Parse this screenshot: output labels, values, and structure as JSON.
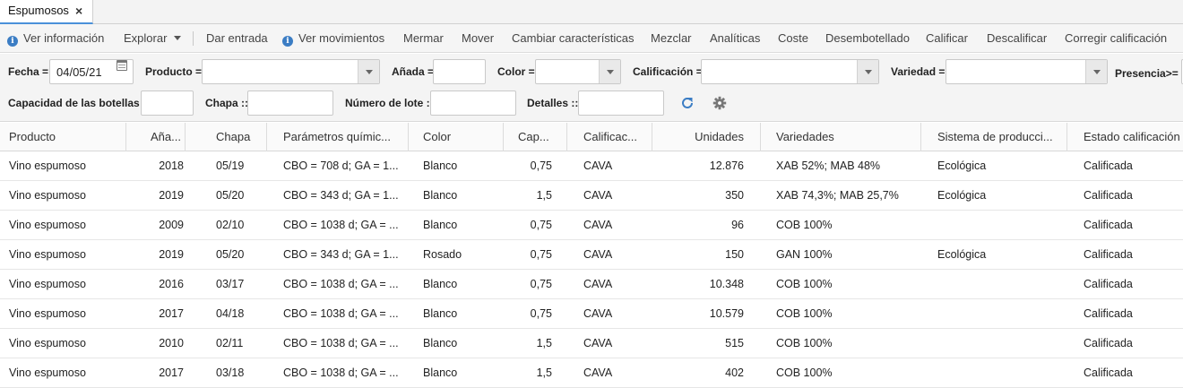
{
  "tab": {
    "title": "Espumosos",
    "close": "×"
  },
  "toolbar": {
    "ver_informacion": "Ver información",
    "explorar": "Explorar",
    "dar_entrada": "Dar entrada",
    "ver_movimientos": "Ver movimientos",
    "mermar": "Mermar",
    "mover": "Mover",
    "cambiar_caracteristicas": "Cambiar características",
    "mezclar": "Mezclar",
    "analiticas": "Analíticas",
    "coste": "Coste",
    "desembotellado": "Desembotellado",
    "calificar": "Calificar",
    "descalificar": "Descalificar",
    "corregir_calificacion": "Corregir calificación"
  },
  "filters": {
    "fecha_label": "Fecha =",
    "fecha_value": "04/05/21",
    "producto_label": "Producto =",
    "anada_label": "Añada =",
    "color_label": "Color =",
    "calificacion_label": "Calificación =",
    "variedad_label": "Variedad =",
    "presencia_label": "Presencia>=",
    "capacidad_label": "Capacidad de las botellas =",
    "chapa_label": "Chapa ::",
    "lote_label": "Número de lote ::",
    "detalles_label": "Detalles ::"
  },
  "table": {
    "headers": [
      "Producto",
      "Aña...",
      "Chapa",
      "Parámetros químic...",
      "Color",
      "Cap...",
      "Calificac...",
      "Unidades",
      "Variedades",
      "Sistema de producci...",
      "Estado calificación"
    ],
    "rows": [
      [
        "Vino espumoso",
        "2018",
        "05/19",
        "CBO = 708 d; GA = 1...",
        "Blanco",
        "0,75",
        "CAVA",
        "12.876",
        "XAB 52%; MAB 48%",
        "Ecológica",
        "Calificada"
      ],
      [
        "Vino espumoso",
        "2019",
        "05/20",
        "CBO = 343 d; GA = 1...",
        "Blanco",
        "1,5",
        "CAVA",
        "350",
        "XAB 74,3%; MAB 25,7%",
        "Ecológica",
        "Calificada"
      ],
      [
        "Vino espumoso",
        "2009",
        "02/10",
        "CBO = 1038 d; GA = ...",
        "Blanco",
        "0,75",
        "CAVA",
        "96",
        "COB 100%",
        "",
        "Calificada"
      ],
      [
        "Vino espumoso",
        "2019",
        "05/20",
        "CBO = 343 d; GA = 1...",
        "Rosado",
        "0,75",
        "CAVA",
        "150",
        "GAN 100%",
        "Ecológica",
        "Calificada"
      ],
      [
        "Vino espumoso",
        "2016",
        "03/17",
        "CBO = 1038 d; GA = ...",
        "Blanco",
        "0,75",
        "CAVA",
        "10.348",
        "COB 100%",
        "",
        "Calificada"
      ],
      [
        "Vino espumoso",
        "2017",
        "04/18",
        "CBO = 1038 d; GA = ...",
        "Blanco",
        "0,75",
        "CAVA",
        "10.579",
        "COB 100%",
        "",
        "Calificada"
      ],
      [
        "Vino espumoso",
        "2010",
        "02/11",
        "CBO = 1038 d; GA = ...",
        "Blanco",
        "1,5",
        "CAVA",
        "515",
        "COB 100%",
        "",
        "Calificada"
      ],
      [
        "Vino espumoso",
        "2017",
        "03/18",
        "CBO = 1038 d; GA = ...",
        "Blanco",
        "1,5",
        "CAVA",
        "402",
        "COB 100%",
        "",
        "Calificada"
      ]
    ]
  }
}
